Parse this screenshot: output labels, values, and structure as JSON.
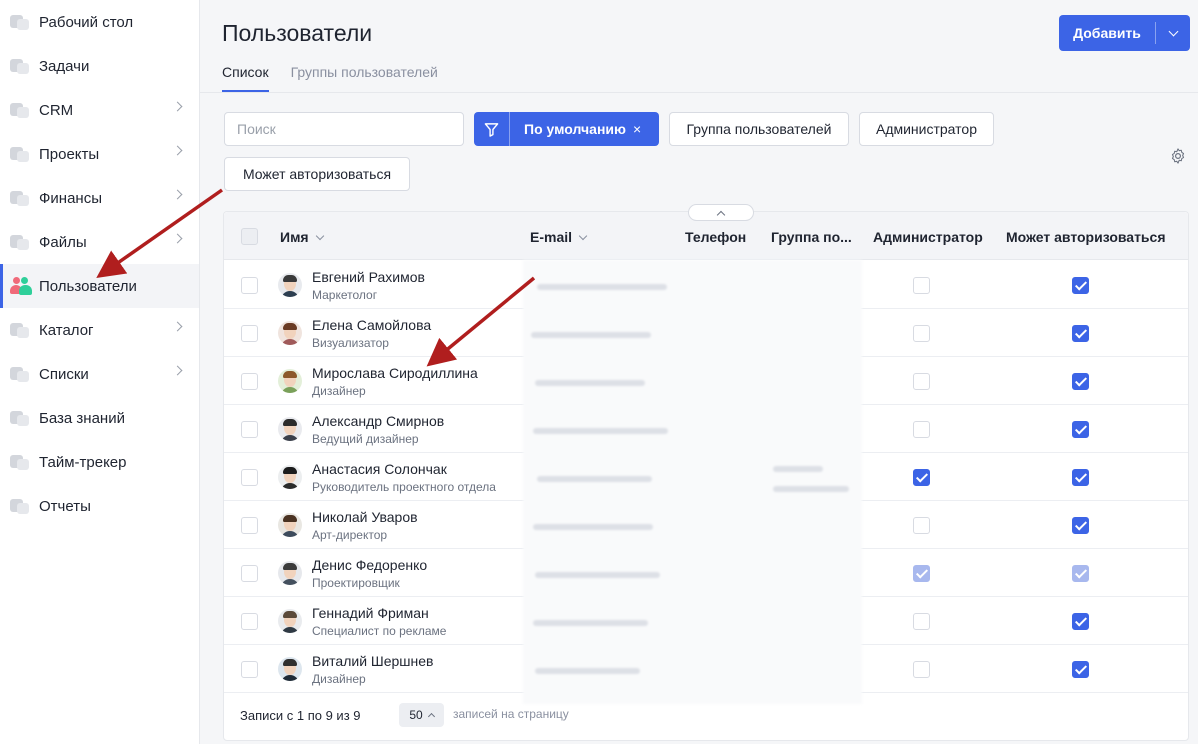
{
  "sidebar": {
    "items": [
      {
        "label": "Рабочий стол",
        "icon": "dashboard-icon",
        "expandable": false
      },
      {
        "label": "Задачи",
        "icon": "tasks-icon",
        "expandable": false
      },
      {
        "label": "CRM",
        "icon": "crm-icon",
        "expandable": true
      },
      {
        "label": "Проекты",
        "icon": "projects-icon",
        "expandable": true
      },
      {
        "label": "Финансы",
        "icon": "finance-icon",
        "expandable": true
      },
      {
        "label": "Файлы",
        "icon": "files-icon",
        "expandable": true
      },
      {
        "label": "Пользователи",
        "icon": "users-icon",
        "expandable": false,
        "active": true
      },
      {
        "label": "Каталог",
        "icon": "catalog-icon",
        "expandable": true
      },
      {
        "label": "Списки",
        "icon": "lists-icon",
        "expandable": true
      },
      {
        "label": "База знаний",
        "icon": "knowledge-base-icon",
        "expandable": false
      },
      {
        "label": "Тайм-трекер",
        "icon": "time-tracker-icon",
        "expandable": false
      },
      {
        "label": "Отчеты",
        "icon": "reports-icon",
        "expandable": false
      }
    ]
  },
  "header": {
    "title": "Пользователи",
    "tabs": [
      {
        "label": "Список",
        "active": true
      },
      {
        "label": "Группы пользователей",
        "active": false
      }
    ],
    "add_button": "Добавить"
  },
  "filters": {
    "search_placeholder": "Поиск",
    "preset": "По умолчанию",
    "preset_clear": "×",
    "chips": [
      "Группа пользователей",
      "Администратор",
      "Может авторизоваться"
    ]
  },
  "table": {
    "columns": {
      "name": "Имя",
      "email": "E-mail",
      "phone": "Телефон",
      "group": "Группа по...",
      "admin": "Администратор",
      "can_login": "Может авторизоваться"
    },
    "rows": [
      {
        "name": "Евгений Рахимов",
        "position": "Маркетолог",
        "admin": "off",
        "can_login": "on"
      },
      {
        "name": "Елена Самойлова",
        "position": "Визуализатор",
        "admin": "off",
        "can_login": "on"
      },
      {
        "name": "Мирослава Сиродиллина",
        "position": "Дизайнер",
        "admin": "off",
        "can_login": "on"
      },
      {
        "name": "Александр Смирнов",
        "position": "Ведущий дизайнер",
        "admin": "off",
        "can_login": "on"
      },
      {
        "name": "Анастасия Солончак",
        "position": "Руководитель проектного отдела",
        "admin": "on",
        "can_login": "on"
      },
      {
        "name": "Николай Уваров",
        "position": "Арт-директор",
        "admin": "off",
        "can_login": "on"
      },
      {
        "name": "Денис Федоренко",
        "position": "Проектировщик",
        "admin": "disabled",
        "can_login": "disabled"
      },
      {
        "name": "Геннадий Фриман",
        "position": "Специалист по рекламе",
        "admin": "off",
        "can_login": "on"
      },
      {
        "name": "Виталий Шершнев",
        "position": "Дизайнер",
        "admin": "off",
        "can_login": "on"
      }
    ],
    "footer": {
      "records": "Записи с 1 по 9 из 9",
      "per_page_value": "50",
      "per_page_label": "записей на страницу"
    }
  },
  "colors": {
    "accent": "#3c64e6",
    "annotation_arrow": "#b01e1e"
  }
}
